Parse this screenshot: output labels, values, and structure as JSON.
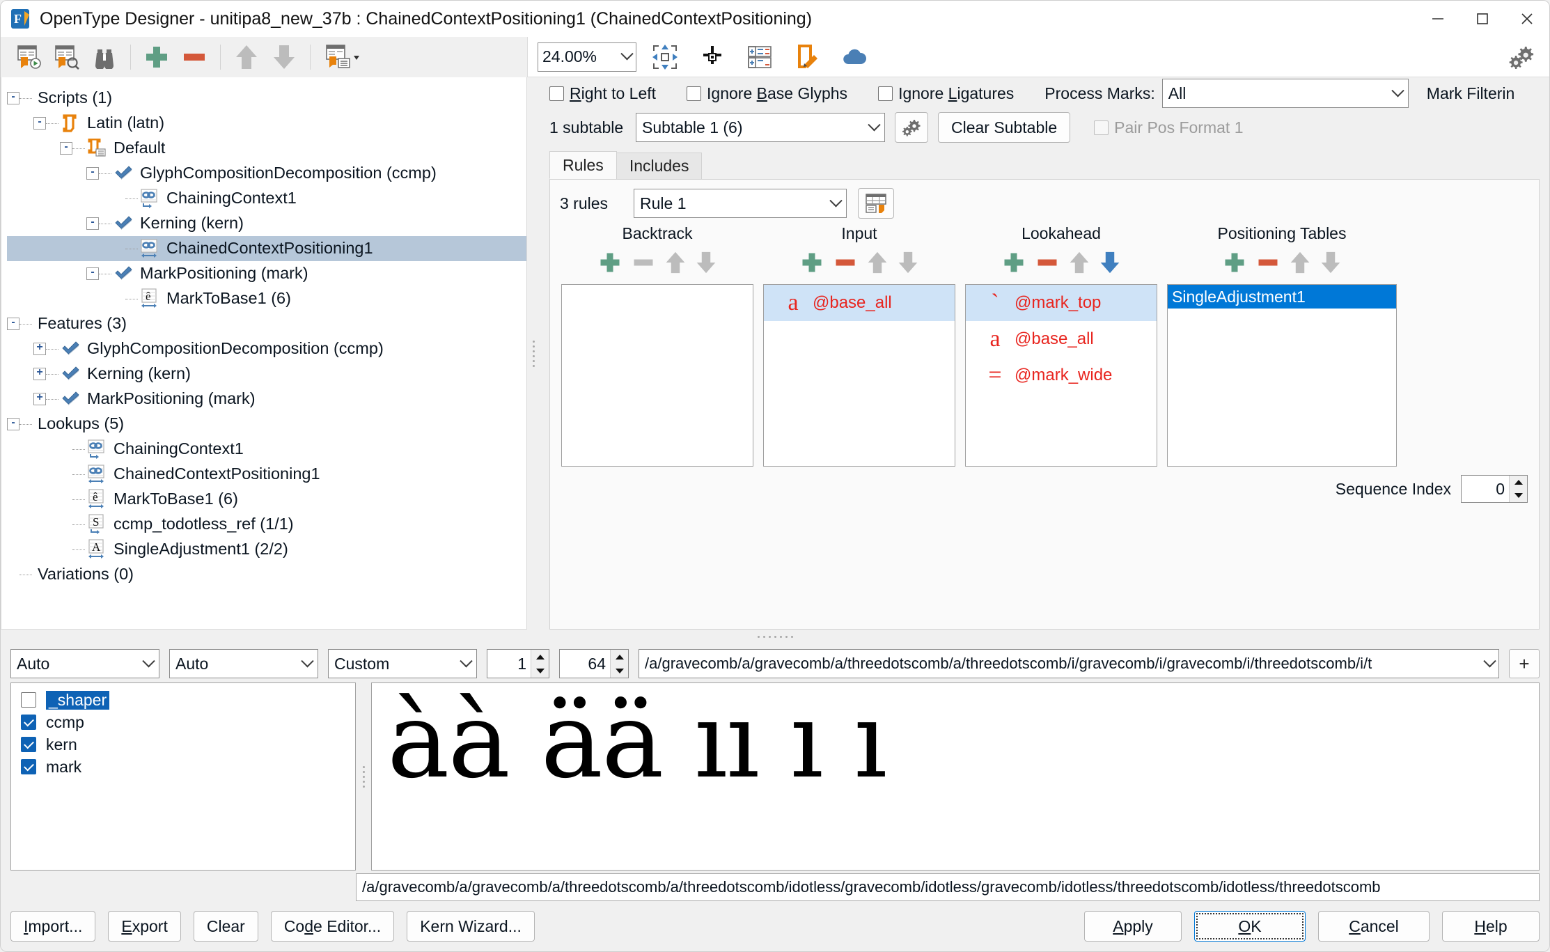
{
  "window": {
    "title": "OpenType Designer - unitipa8_new_37b : ChainedContextPositioning1 (ChainedContextPositioning)",
    "app_icon": "opentype-designer-icon",
    "minimize": "minimize-icon",
    "maximize": "maximize-icon",
    "close": "close-icon"
  },
  "toolbar_left": {
    "items": [
      {
        "name": "run-lookup-icon"
      },
      {
        "name": "inspect-lookup-icon"
      },
      {
        "name": "binoculars-find-icon"
      },
      {
        "name": "add-icon"
      },
      {
        "name": "remove-icon"
      },
      {
        "name": "move-up-icon"
      },
      {
        "name": "move-down-icon"
      },
      {
        "name": "lookup-properties-icon"
      }
    ]
  },
  "toolbar_right": {
    "zoom": "24.00%",
    "items": [
      {
        "name": "fit-to-window-icon"
      },
      {
        "name": "center-origin-icon"
      },
      {
        "name": "table-grid-icon"
      },
      {
        "name": "edit-glyph-icon"
      },
      {
        "name": "cloud-icon"
      },
      {
        "name": "settings-gears-icon"
      }
    ]
  },
  "tree": {
    "nodes": [
      {
        "label": "Scripts (1)",
        "indent": 0,
        "toggle": "-",
        "icon": "",
        "selected": false
      },
      {
        "label": "Latin (latn)",
        "indent": 1,
        "toggle": "-",
        "icon": "script-icon",
        "selected": false
      },
      {
        "label": "Default",
        "indent": 2,
        "toggle": "-",
        "icon": "langsys-icon",
        "selected": false
      },
      {
        "label": "GlyphCompositionDecomposition (ccmp)",
        "indent": 3,
        "toggle": "-",
        "icon": "feature-icon",
        "selected": false
      },
      {
        "label": "ChainingContext1",
        "indent": 4,
        "toggle": "",
        "icon": "chaining-sub-icon",
        "selected": false
      },
      {
        "label": "Kerning (kern)",
        "indent": 3,
        "toggle": "-",
        "icon": "feature-icon",
        "selected": false
      },
      {
        "label": "ChainedContextPositioning1",
        "indent": 4,
        "toggle": "",
        "icon": "chaining-pos-icon",
        "selected": true
      },
      {
        "label": "MarkPositioning (mark)",
        "indent": 3,
        "toggle": "-",
        "icon": "feature-icon",
        "selected": false
      },
      {
        "label": "MarkToBase1 (6)",
        "indent": 4,
        "toggle": "",
        "icon": "marktobase-icon",
        "selected": false
      },
      {
        "label": "Features (3)",
        "indent": 0,
        "toggle": "-",
        "icon": "",
        "selected": false
      },
      {
        "label": "GlyphCompositionDecomposition (ccmp)",
        "indent": 1,
        "toggle": "+",
        "icon": "feature-icon",
        "selected": false
      },
      {
        "label": "Kerning (kern)",
        "indent": 1,
        "toggle": "+",
        "icon": "feature-icon",
        "selected": false
      },
      {
        "label": "MarkPositioning (mark)",
        "indent": 1,
        "toggle": "+",
        "icon": "feature-icon",
        "selected": false
      },
      {
        "label": "Lookups (5)",
        "indent": 0,
        "toggle": "-",
        "icon": "",
        "selected": false
      },
      {
        "label": "ChainingContext1",
        "indent": 2,
        "toggle": "",
        "icon": "chaining-sub-icon",
        "selected": false
      },
      {
        "label": "ChainedContextPositioning1",
        "indent": 2,
        "toggle": "",
        "icon": "chaining-pos-icon",
        "selected": false
      },
      {
        "label": "MarkToBase1 (6)",
        "indent": 2,
        "toggle": "",
        "icon": "marktobase-icon",
        "selected": false
      },
      {
        "label": "ccmp_todotless_ref (1/1)",
        "indent": 2,
        "toggle": "",
        "icon": "single-sub-icon",
        "selected": false
      },
      {
        "label": "SingleAdjustment1 (2/2)",
        "indent": 2,
        "toggle": "",
        "icon": "single-adj-icon",
        "selected": false
      },
      {
        "label": "Variations (0)",
        "indent": 0,
        "toggle": "",
        "icon": "",
        "selected": false
      }
    ]
  },
  "options": {
    "right_to_left": {
      "label": "Right to Left",
      "checked": false
    },
    "ignore_base_glyphs": {
      "label": "Ignore Base Glyphs",
      "checked": false
    },
    "ignore_ligatures": {
      "label": "Ignore Ligatures",
      "checked": false
    },
    "process_marks_label": "Process Marks:",
    "process_marks_value": "All",
    "mark_filtering_label": "Mark Filterin",
    "subtable_count_label": "1 subtable",
    "subtable_value": "Subtable 1 (6)",
    "subtable_settings_icon": "subtable-settings-icon",
    "clear_subtable_label": "Clear Subtable",
    "pair_pos_format_1": {
      "label": "Pair Pos Format 1",
      "checked": false,
      "disabled": true
    }
  },
  "tabs": [
    {
      "label": "Rules",
      "active": true
    },
    {
      "label": "Includes",
      "active": false
    }
  ],
  "rules": {
    "count_label": "3 rules",
    "selected_rule": "Rule 1",
    "rule_table_icon": "rule-table-icon",
    "columns": [
      {
        "title": "Backtrack",
        "tools": [
          {
            "name": "add-icon",
            "state": "enabled"
          },
          {
            "name": "remove-icon",
            "state": "disabled"
          },
          {
            "name": "move-up-icon",
            "state": "disabled"
          },
          {
            "name": "move-down-icon",
            "state": "disabled"
          }
        ],
        "items": []
      },
      {
        "title": "Input",
        "tools": [
          {
            "name": "add-icon",
            "state": "enabled"
          },
          {
            "name": "remove-icon",
            "state": "enabled"
          },
          {
            "name": "move-up-icon",
            "state": "disabled"
          },
          {
            "name": "move-down-icon",
            "state": "disabled"
          }
        ],
        "items": [
          {
            "glyph": "a",
            "label": "@base_all",
            "selected": true
          }
        ]
      },
      {
        "title": "Lookahead",
        "tools": [
          {
            "name": "add-icon",
            "state": "enabled"
          },
          {
            "name": "remove-icon",
            "state": "enabled"
          },
          {
            "name": "move-up-icon",
            "state": "disabled"
          },
          {
            "name": "move-down-icon",
            "state": "enabled"
          }
        ],
        "items": [
          {
            "glyph": "`",
            "label": "@mark_top",
            "selected": true
          },
          {
            "glyph": "a",
            "label": "@base_all",
            "selected": false
          },
          {
            "glyph": "=",
            "label": "@mark_wide",
            "selected": false
          }
        ]
      },
      {
        "title": "Positioning Tables",
        "tools": [
          {
            "name": "add-icon",
            "state": "enabled"
          },
          {
            "name": "remove-icon",
            "state": "enabled"
          },
          {
            "name": "move-up-icon",
            "state": "disabled"
          },
          {
            "name": "move-down-icon",
            "state": "disabled"
          }
        ],
        "items": [
          {
            "glyph": "",
            "label": "SingleAdjustment1",
            "selected": true
          }
        ]
      }
    ],
    "sequence_index_label": "Sequence Index",
    "sequence_index_value": "0"
  },
  "bottom": {
    "controls": {
      "script_select": "Auto",
      "language_select": "Auto",
      "direction_select": "Custom",
      "spin1": "1",
      "spin2": "64",
      "text_value": "/a/gravecomb/a/gravecomb/a/threedotscomb/a/threedotscomb/i/gravecomb/i/gravecomb/i/threedotscomb/i/t",
      "add_button": "+"
    },
    "features": [
      {
        "label": "_shaper",
        "checked": false,
        "selected": true
      },
      {
        "label": "ccmp",
        "checked": true,
        "selected": false
      },
      {
        "label": "kern",
        "checked": true,
        "selected": false
      },
      {
        "label": "mark",
        "checked": true,
        "selected": false
      }
    ],
    "preview_glyphs": "àà ää ıı ı ı",
    "status_text": "/a/gravecomb/a/gravecomb/a/threedotscomb/a/threedotscomb/idotless/gravecomb/idotless/gravecomb/idotless/threedotscomb/idotless/threedotscomb"
  },
  "buttons": {
    "import": "Import...",
    "export": "Export",
    "clear": "Clear",
    "code_editor": "Code Editor...",
    "kern_wizard": "Kern Wizard...",
    "apply": "Apply",
    "ok": "OK",
    "cancel": "Cancel",
    "help": "Help"
  },
  "colors": {
    "accent_blue": "#0078d7",
    "selection_tree": "#b6c7d9",
    "glyph_red": "#e8251f",
    "add_green": "#5f9e84",
    "remove_orange": "#d4583a",
    "icon_orange": "#e8820c",
    "icon_blue": "#4a7fb5"
  }
}
